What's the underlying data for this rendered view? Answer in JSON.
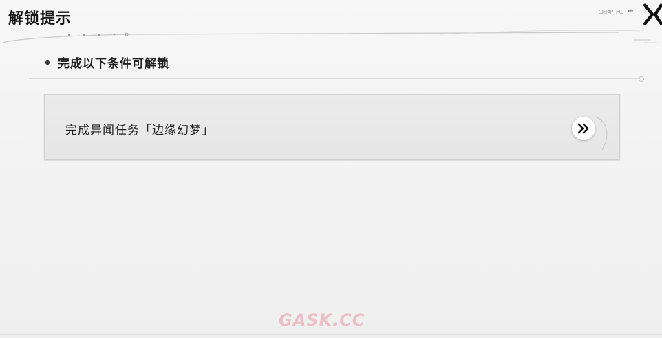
{
  "header": {
    "title": "解锁提示",
    "small_text": "ᗝᗺᗏᑭ ᑭᑕ",
    "arrow_glyph": "⇼"
  },
  "section": {
    "title": "完成以下条件可解锁"
  },
  "condition": {
    "text": "完成异闻任务「边缘幻梦」"
  },
  "icons": {
    "close": "close-x-icon",
    "go": "double-chevron-right-icon",
    "bullet": "diamond-bullet-icon"
  },
  "colors": {
    "background": "#f3f3f3",
    "card": "#e8e8e8",
    "text": "#1f1f1f",
    "accent_dark": "#161616"
  },
  "watermark": {
    "text": "GASK.CC"
  }
}
